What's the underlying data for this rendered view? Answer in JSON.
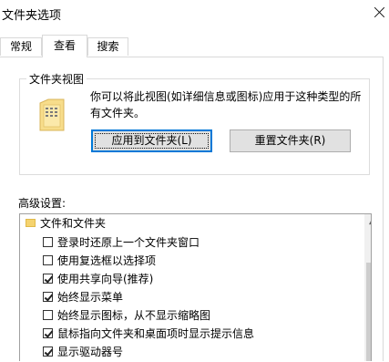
{
  "window": {
    "title": "文件夹选项"
  },
  "tabs": [
    {
      "label": "常规"
    },
    {
      "label": "查看"
    },
    {
      "label": "搜索"
    }
  ],
  "folder_views": {
    "legend": "文件夹视图",
    "description": "你可以将此视图(如详细信息或图标)应用于这种类型的所有文件夹。",
    "apply_button": "应用到文件夹(L)",
    "reset_button": "重置文件夹(R)"
  },
  "advanced": {
    "label": "高级设置:",
    "root": "文件和文件夹",
    "items": [
      {
        "label": "登录时还原上一个文件夹窗口",
        "checked": false
      },
      {
        "label": "使用复选框以选择项",
        "checked": false
      },
      {
        "label": "使用共享向导(推荐)",
        "checked": true
      },
      {
        "label": "始终显示菜单",
        "checked": true
      },
      {
        "label": "始终显示图标，从不显示缩略图",
        "checked": false
      },
      {
        "label": "鼠标指向文件夹和桌面项时显示提示信息",
        "checked": true
      },
      {
        "label": "显示驱动器号",
        "checked": true
      }
    ]
  }
}
